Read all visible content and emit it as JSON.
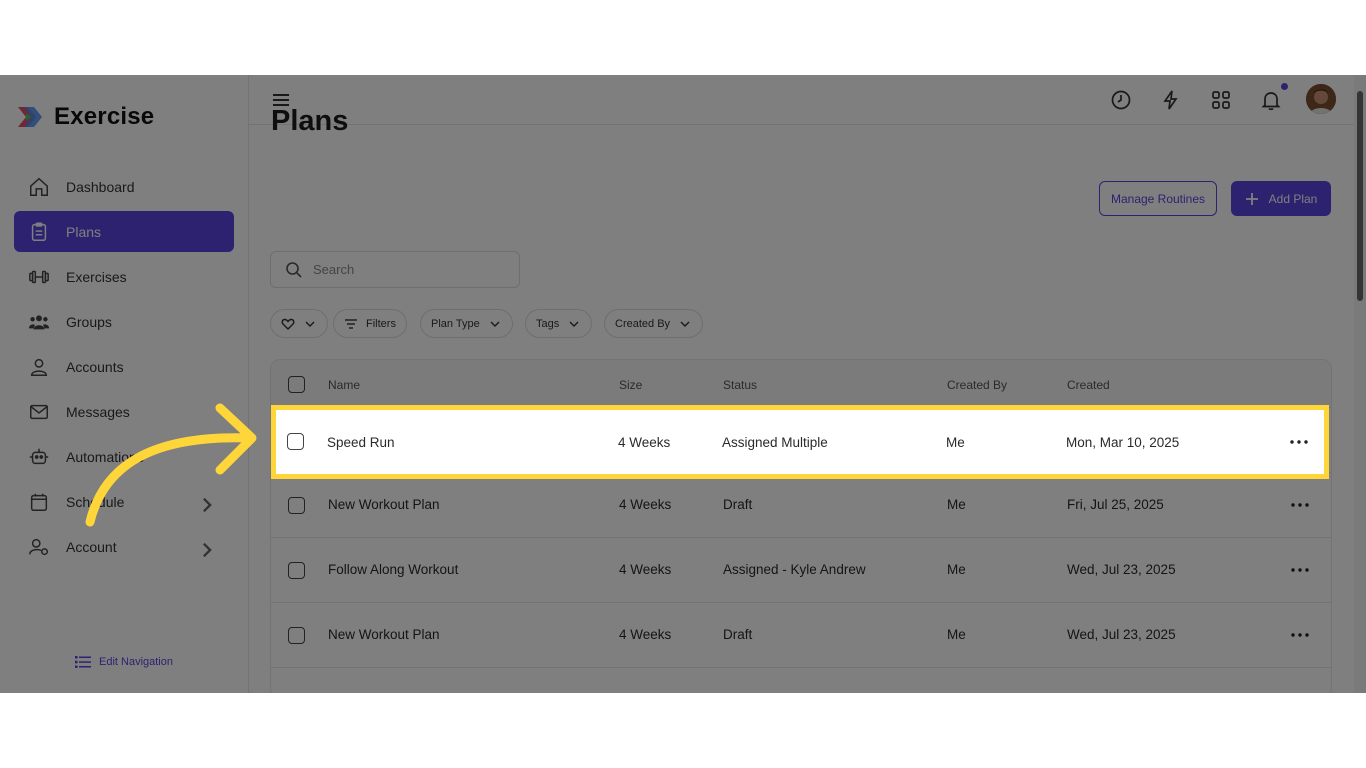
{
  "app": {
    "brand": "Exercise"
  },
  "sidebar": {
    "items": [
      {
        "label": "Dashboard",
        "icon": "home-icon"
      },
      {
        "label": "Plans",
        "icon": "clipboard-icon",
        "active": true
      },
      {
        "label": "Exercises",
        "icon": "dumbbell-icon"
      },
      {
        "label": "Groups",
        "icon": "users-icon"
      },
      {
        "label": "Accounts",
        "icon": "user-icon"
      },
      {
        "label": "Messages",
        "icon": "mail-icon"
      },
      {
        "label": "Automations",
        "icon": "robot-icon"
      },
      {
        "label": "Schedule",
        "icon": "calendar-icon"
      },
      {
        "label": "Account",
        "icon": "user-gear-icon"
      }
    ],
    "edit_nav": "Edit Navigation"
  },
  "header": {
    "icons": [
      "clock-icon",
      "bolt-icon",
      "grid-icon",
      "bell-icon"
    ],
    "accent": "#5b44e0"
  },
  "main": {
    "title": "Plans",
    "manage_routines": "Manage Routines",
    "add_plan": "Add Plan",
    "search_placeholder": "Search",
    "filters": {
      "filters": "Filters",
      "plan_type": "Plan Type",
      "tags": "Tags",
      "created_by": "Created By"
    },
    "table": {
      "columns": [
        "Name",
        "Size",
        "Status",
        "Created By",
        "Created"
      ],
      "rows": [
        {
          "name": "Speed Run",
          "size": "4 Weeks",
          "status": "Assigned Multiple",
          "created_by": "Me",
          "created": "Mon, Mar 10, 2025"
        },
        {
          "name": "New Workout Plan",
          "size": "4 Weeks",
          "status": "Draft",
          "created_by": "Me",
          "created": "Fri, Jul 25, 2025"
        },
        {
          "name": "Follow Along Workout",
          "size": "4 Weeks",
          "status": "Assigned - Kyle Andrew",
          "created_by": "Me",
          "created": "Wed, Jul 23, 2025"
        },
        {
          "name": "New Workout Plan",
          "size": "4 Weeks",
          "status": "Draft",
          "created_by": "Me",
          "created": "Wed, Jul 23, 2025"
        }
      ]
    }
  },
  "annotation": {
    "highlight_color": "#ffd63a"
  }
}
